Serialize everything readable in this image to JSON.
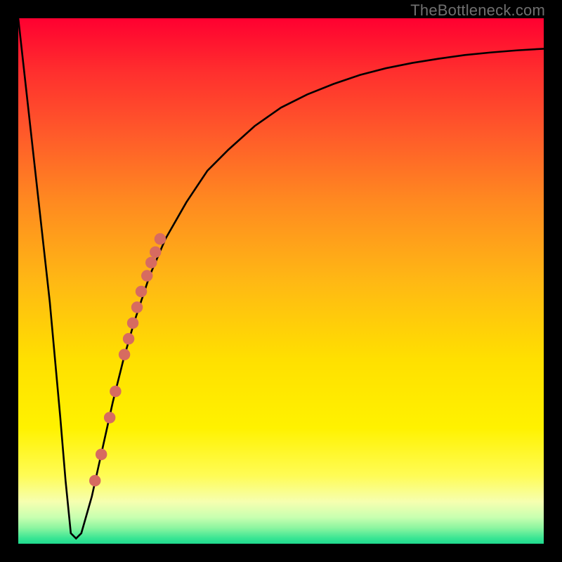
{
  "watermark": "TheBottleneck.com",
  "colors": {
    "curve_stroke": "#000000",
    "marker_stroke": "#d76b60",
    "marker_fill": "#d76b60"
  },
  "chart_data": {
    "type": "line",
    "title": "",
    "xlabel": "",
    "ylabel": "",
    "xlim": [
      0,
      100
    ],
    "ylim": [
      0,
      100
    ],
    "grid": false,
    "series": [
      {
        "name": "bottleneck-curve",
        "x": [
          0,
          2,
          4,
          6,
          8,
          9,
          10,
          11,
          12,
          14,
          16,
          18,
          20,
          22,
          25,
          28,
          32,
          36,
          40,
          45,
          50,
          55,
          60,
          65,
          70,
          75,
          80,
          85,
          90,
          95,
          100
        ],
        "y": [
          100,
          82,
          64,
          46,
          24,
          12,
          2,
          1,
          2,
          9,
          18,
          27,
          35,
          42,
          51,
          58,
          65,
          71,
          75,
          79.5,
          83,
          85.5,
          87.5,
          89.2,
          90.5,
          91.5,
          92.3,
          93,
          93.5,
          93.9,
          94.2
        ]
      }
    ],
    "scatter": [
      {
        "name": "highlight-dots",
        "x": [
          14.6,
          15.8,
          17.4,
          18.5,
          20.2,
          21.0,
          21.8,
          22.6,
          23.4,
          24.5,
          25.3,
          26.1,
          27.0
        ],
        "y": [
          12,
          17,
          24,
          29,
          36,
          39,
          42,
          45,
          48,
          51,
          53.5,
          55.5,
          58
        ]
      }
    ]
  }
}
